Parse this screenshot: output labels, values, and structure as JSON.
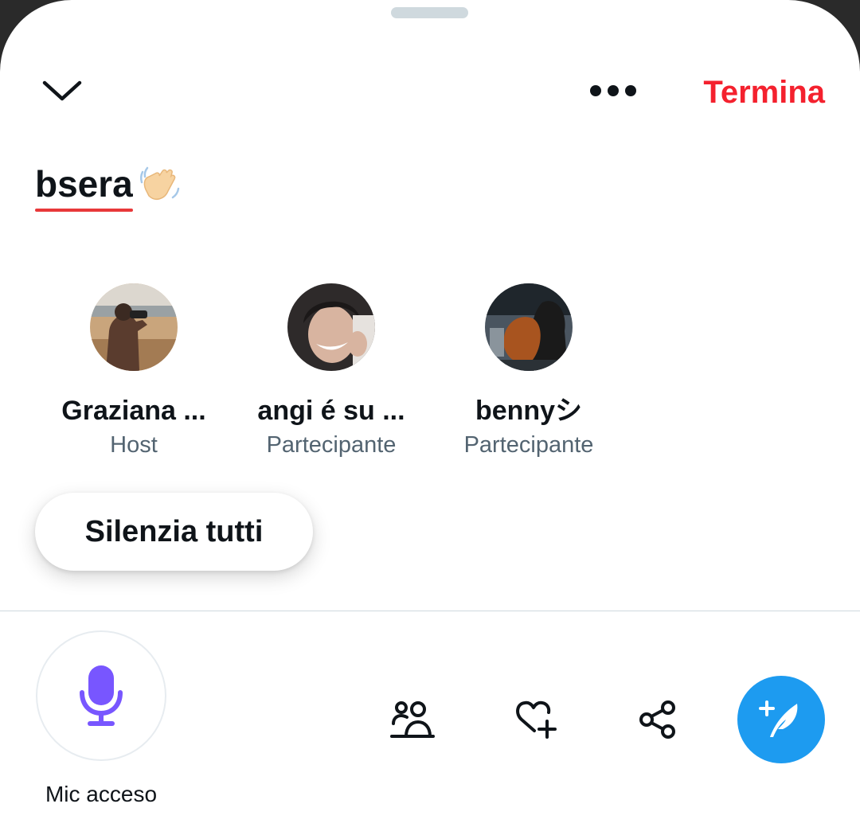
{
  "header": {
    "end_label": "Termina",
    "collapse_icon": "chevron-down-icon",
    "more_icon": "more-horizontal-icon"
  },
  "space": {
    "title": "bsera",
    "title_emoji": "waving-hand-emoji"
  },
  "speakers": [
    {
      "name": "Graziana ...",
      "role": "Host"
    },
    {
      "name": "angi é su ...",
      "role": "Partecipante"
    },
    {
      "name": "bennyシ",
      "role": "Partecipante"
    }
  ],
  "controls": {
    "mute_all_label": "Silenzia tutti",
    "mic_label": "Mic acceso",
    "mic_icon": "microphone-icon",
    "actions": [
      "people-icon",
      "heart-plus-icon",
      "share-icon",
      "compose-icon"
    ]
  },
  "colors": {
    "end_red": "#f4212e",
    "mic_purple": "#7856ff",
    "compose_blue": "#1d9bf0",
    "secondary_text": "#536471"
  }
}
